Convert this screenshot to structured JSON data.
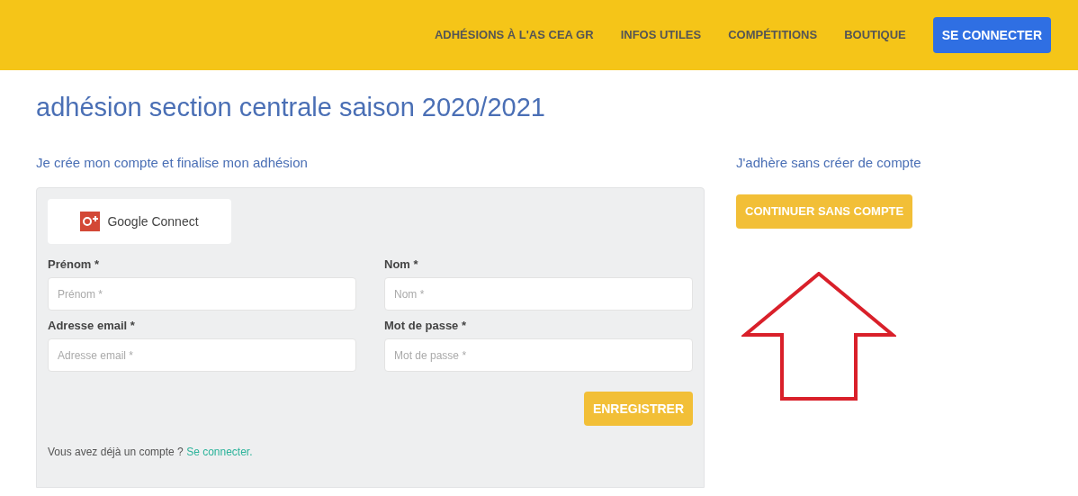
{
  "nav": {
    "items": [
      {
        "label": "ADHÉSIONS À L'AS CEA GR"
      },
      {
        "label": "INFOS UTILES"
      },
      {
        "label": "COMPÉTITIONS"
      },
      {
        "label": "BOUTIQUE"
      }
    ],
    "login_button": "SE CONNECTER"
  },
  "title": "adhésion section centrale saison 2020/2021",
  "account_section": {
    "heading": "Je crée mon compte et finalise mon adhésion",
    "google_button": "Google Connect",
    "fields": [
      {
        "label": "Prénom *",
        "placeholder": "Prénom *"
      },
      {
        "label": "Nom *",
        "placeholder": "Nom *"
      },
      {
        "label": "Adresse email *",
        "placeholder": "Adresse email *"
      },
      {
        "label": "Mot de passe *",
        "placeholder": "Mot de passe *"
      }
    ],
    "submit_button": "ENREGISTRER",
    "login_prompt": "Vous avez déjà un compte ?",
    "login_link": "Se connecter."
  },
  "guest_section": {
    "heading": "J'adhère sans créer de compte",
    "button": "CONTINUER SANS COMPTE"
  }
}
